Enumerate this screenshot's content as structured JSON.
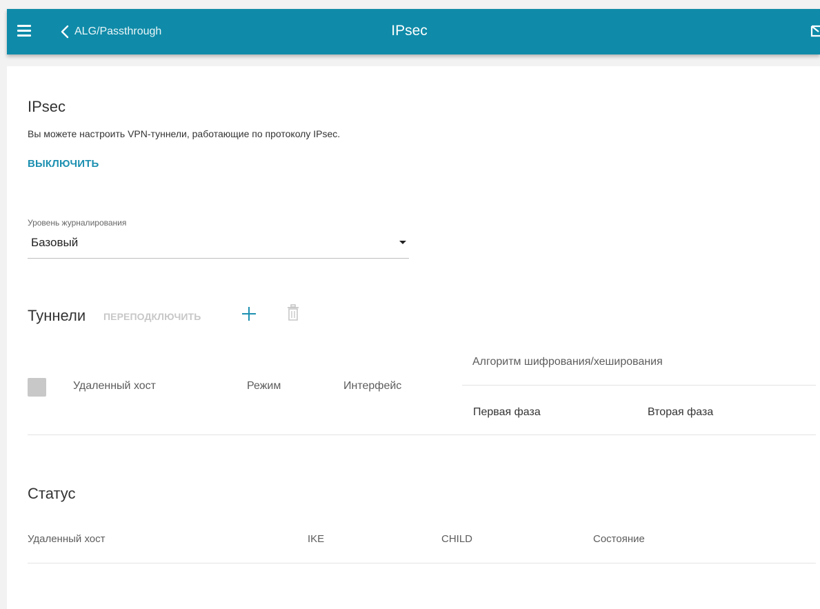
{
  "header": {
    "back_label": "ALG/Passthrough",
    "title": "IPsec",
    "bar_color": "#0f8ba9"
  },
  "icons": {
    "menu": "hamburger-menu-icon",
    "back": "chevron-left-icon",
    "notifications": "envelope-icon",
    "add": "plus-icon",
    "delete": "trash-icon",
    "dropdown": "caret-down-icon"
  },
  "section": {
    "title": "IPsec",
    "description": "Вы можете настроить VPN-туннели, работающие по протоколу IPsec.",
    "toggle_label": "ВЫКЛЮЧИТЬ",
    "accent_color": "#1b8fb0"
  },
  "log_level": {
    "label": "Уровень журналирования",
    "value": "Базовый"
  },
  "tunnels": {
    "title": "Туннели",
    "reconnect_label": "ПЕРЕПОДКЛЮЧИТЬ",
    "columns": {
      "remote_host": "Удаленный хост",
      "mode": "Режим",
      "interface": "Интерфейс",
      "algorithm": "Алгоритм шифрования/хеширования",
      "phase1": "Первая фаза",
      "phase2": "Вторая фаза"
    },
    "rows": []
  },
  "status": {
    "title": "Статус",
    "columns": {
      "remote_host": "Удаленный хост",
      "ike": "IKE",
      "child": "CHILD",
      "state": "Состояние"
    },
    "rows": []
  }
}
